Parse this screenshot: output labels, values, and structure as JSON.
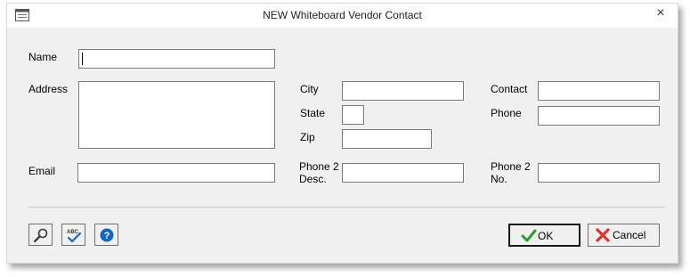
{
  "window": {
    "title": "NEW Whiteboard Vendor Contact"
  },
  "labels": {
    "name": "Name",
    "address": "Address",
    "email": "Email",
    "city": "City",
    "state": "State",
    "zip": "Zip",
    "phone2_desc_line1": "Phone 2",
    "phone2_desc_line2": "Desc.",
    "contact": "Contact",
    "phone": "Phone",
    "phone2_no_line1": "Phone 2",
    "phone2_no_line2": "No."
  },
  "fields": {
    "name": "",
    "address": "",
    "email": "",
    "city": "",
    "state": "",
    "zip": "",
    "phone2_desc": "",
    "contact": "",
    "phone": "",
    "phone2_no": ""
  },
  "buttons": {
    "ok": "OK",
    "cancel": "Cancel"
  },
  "icons": {
    "close": "×",
    "toolbar": [
      "magnifier-icon",
      "spellcheck-icon",
      "help-icon"
    ]
  },
  "colors": {
    "ok_check": "#2a9d2a",
    "cancel_x": "#e0332b",
    "help_blue": "#1565c0"
  }
}
